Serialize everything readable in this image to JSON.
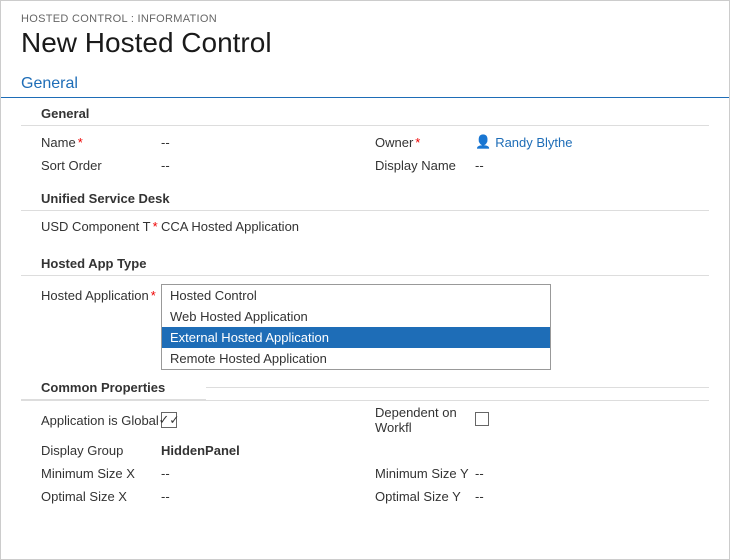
{
  "breadcrumb": "HOSTED CONTROL : INFORMATION",
  "page_title": "New Hosted Control",
  "sections": {
    "general_header": "General",
    "general_subsection": "General",
    "name_label": "Name",
    "name_value": "--",
    "owner_label": "Owner",
    "owner_value": "Randy Blythe",
    "sort_order_label": "Sort Order",
    "sort_order_value": "--",
    "display_name_label": "Display Name",
    "display_name_value": "--",
    "usd_subsection": "Unified Service Desk",
    "usd_component_label": "USD Component T",
    "usd_component_value": "CCA Hosted Application",
    "hosted_app_subsection": "Hosted App Type",
    "hosted_application_label": "Hosted Application",
    "dropdown_items": [
      {
        "label": "Hosted Control",
        "selected": false
      },
      {
        "label": "Web Hosted Application",
        "selected": false
      },
      {
        "label": "External Hosted Application",
        "selected": true
      },
      {
        "label": "Remote Hosted Application",
        "selected": false
      }
    ],
    "common_properties_title": "Common Properties",
    "app_is_global_label": "Application is Global",
    "app_is_global_checked": true,
    "dependent_workfl_label": "Dependent on Workfl",
    "dependent_workfl_checked": false,
    "display_group_label": "Display Group",
    "display_group_value": "HiddenPanel",
    "min_size_x_label": "Minimum Size X",
    "min_size_x_value": "--",
    "min_size_y_label": "Minimum Size Y",
    "min_size_y_value": "--",
    "optimal_size_x_label": "Optimal Size X",
    "optimal_size_x_value": "--",
    "optimal_size_y_label": "Optimal Size Y",
    "optimal_size_y_value": "--"
  },
  "colors": {
    "blue": "#1e6db7",
    "required_red": "#e00000"
  }
}
